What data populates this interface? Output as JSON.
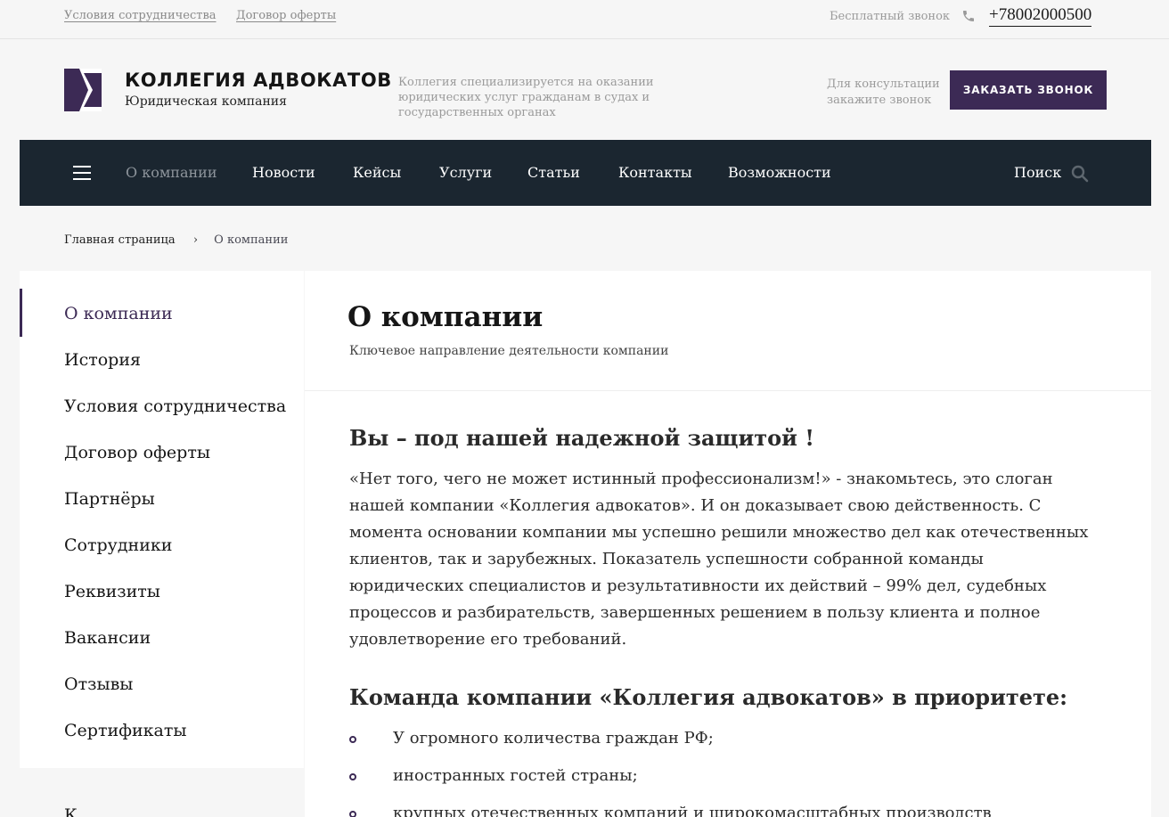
{
  "topbar": {
    "link_terms": "Условия сотрудничества",
    "link_offer": "Договор оферты",
    "free_call": "Бесплатный звонок",
    "phone": "+78002000500",
    "phone_icon": "phone-icon"
  },
  "header": {
    "brand_name": "КОЛЛЕГИЯ АДВОКАТОВ",
    "brand_tagline": "Юридическая компания",
    "description": "Коллегия специализируется на оказании юридических услуг гражданам в судах и государственных органах",
    "consult_note": "Для консультации закажите звонок",
    "order_button": "ЗАКАЗАТЬ ЗВОНОК",
    "accent_color": "#3c2a55"
  },
  "nav": {
    "items": [
      "О компании",
      "Новости",
      "Кейсы",
      "Услуги",
      "Статьи",
      "Контакты",
      "Возможности"
    ],
    "active_index": 0,
    "search_label": "Поиск",
    "background": "#1b2630"
  },
  "breadcrumb": {
    "home": "Главная страница",
    "current": "О компании"
  },
  "sidebar": {
    "items": [
      "О компании",
      "История",
      "Условия сотрудничества",
      "Договор оферты",
      "Партнёры",
      "Сотрудники",
      "Реквизиты",
      "Вакансии",
      "Отзывы",
      "Сертификаты"
    ],
    "active_index": 0,
    "extra_item_partial": "К"
  },
  "content": {
    "title": "О компании",
    "subtitle": "Ключевое направление деятельности компании",
    "section1_title": "Вы – под нашей надежной защитой !",
    "section1_text": "«Нет того, чего не может истинный профессионализм!» - знакомьтесь, это слоган нашей компании «Коллегия адвокатов». И он доказывает свою действенность. С момента основании компании мы успешно решили множество дел как отечественных клиентов, так и зарубежных. Показатель успешности собранной команды юридических специалистов и результативности их действий – 99% дел, судебных процессов и разбирательств, завершенных решением в пользу клиента и полное удовлетворение его требований.",
    "section2_title": "Команда компании «Коллегия адвокатов» в приоритете:",
    "bullets": [
      "У огромного количества граждан РФ;",
      "иностранных гостей страны;",
      "крупных отечественных компаний и широкомасштабных производств"
    ]
  }
}
